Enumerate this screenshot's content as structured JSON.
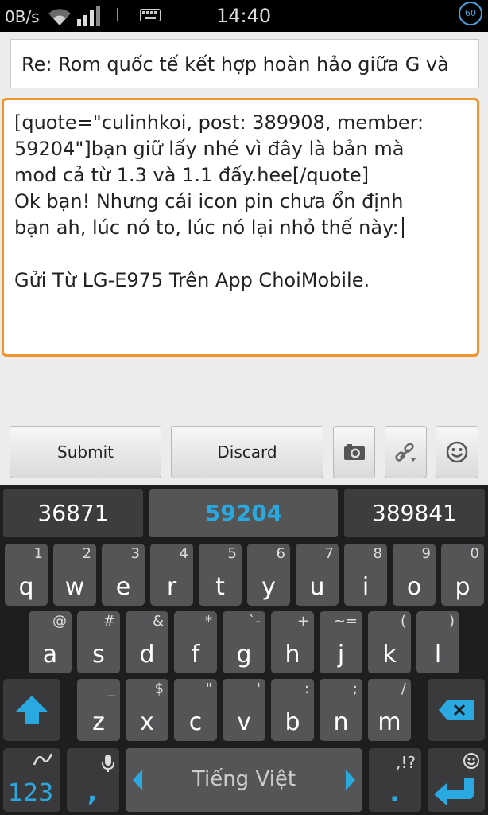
{
  "status_bar": {
    "net_speed": "0B/s",
    "time": "14:40",
    "badge": "60",
    "icons": [
      "wifi-icon",
      "signal-icon",
      "keyboard-icon",
      "badge-icon"
    ]
  },
  "subject": {
    "value": "Re: Rom quốc tế kết hợp hoàn hảo giữa G và"
  },
  "body": {
    "lines": [
      "[quote=\"culinhkoi, post: 389908, member:",
      "59204\"]bạn giữ lấy nhé vì đây là bản mà",
      "mod cả từ 1.3 và 1.1 đấy.hee[/quote]",
      "Ok bạn! Nhưng cái icon pin chưa ổn định",
      "bạn ah, lúc nó to, lúc nó lại nhỏ thế này:",
      "",
      "Gửi Từ LG-E975 Trên  App  ChoiMobile."
    ]
  },
  "actions": {
    "submit": "Submit",
    "discard": "Discard",
    "icons": [
      "camera-icon",
      "link-icon",
      "smiley-icon"
    ]
  },
  "keyboard": {
    "suggestions": [
      "36871",
      "59204",
      "389841"
    ],
    "row1": [
      {
        "key": "q",
        "alt": "1"
      },
      {
        "key": "w",
        "alt": "2"
      },
      {
        "key": "e",
        "alt": "3"
      },
      {
        "key": "r",
        "alt": "4"
      },
      {
        "key": "t",
        "alt": "5"
      },
      {
        "key": "y",
        "alt": "6"
      },
      {
        "key": "u",
        "alt": "7"
      },
      {
        "key": "i",
        "alt": "8"
      },
      {
        "key": "o",
        "alt": "9"
      },
      {
        "key": "p",
        "alt": "0"
      }
    ],
    "row2": [
      {
        "key": "a",
        "alt": "@"
      },
      {
        "key": "s",
        "alt": "#"
      },
      {
        "key": "d",
        "alt": "&"
      },
      {
        "key": "f",
        "alt": "*"
      },
      {
        "key": "g",
        "alt": "`-"
      },
      {
        "key": "h",
        "alt": "+"
      },
      {
        "key": "j",
        "alt": "~="
      },
      {
        "key": "k",
        "alt": "("
      },
      {
        "key": "l",
        "alt": ")"
      }
    ],
    "row3": [
      {
        "key": "z",
        "alt": "_"
      },
      {
        "key": "x",
        "alt": "$"
      },
      {
        "key": "c",
        "alt": "\""
      },
      {
        "key": "v",
        "alt": "'"
      },
      {
        "key": "b",
        "alt": ":"
      },
      {
        "key": "n",
        "alt": ";"
      },
      {
        "key": "m",
        "alt": "/"
      }
    ],
    "symbols_label": "123",
    "comma": ",",
    "language": "Tiếng Việt",
    "period": ".",
    "period_alt": ",!?",
    "icons": [
      "shift-icon",
      "backspace-icon",
      "swype-icon",
      "mic-icon",
      "left-arrow-icon",
      "right-arrow-icon",
      "enter-icon",
      "emoji-icon"
    ],
    "accent_color": "#2aa8e0"
  }
}
